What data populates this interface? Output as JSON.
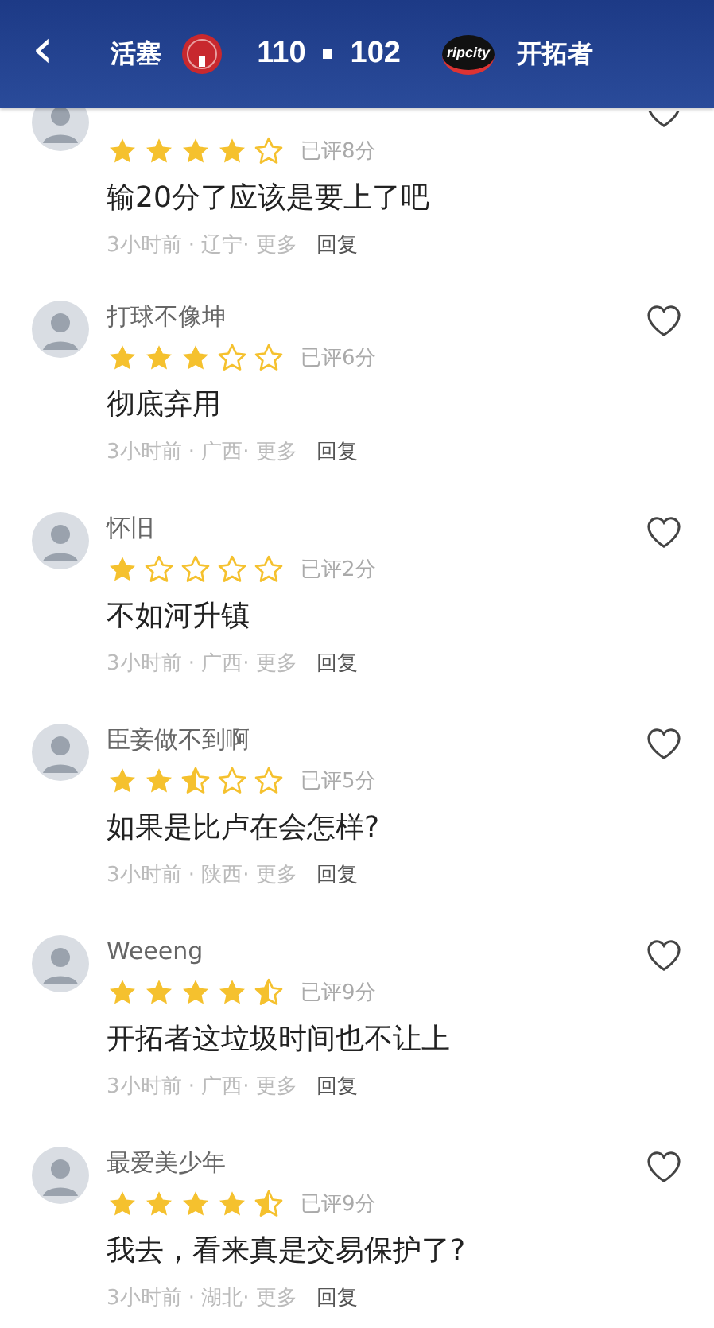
{
  "header": {
    "back": "‹",
    "home_team": "活塞",
    "home_score": "110",
    "away_score": "102",
    "away_logo_text": "ripcity",
    "away_team": "开拓者"
  },
  "comments": [
    {
      "stars": 4,
      "score": "已评8分",
      "text": "输20分了应该是要上了吧",
      "meta": "3小时前 · 辽宁· 更多",
      "reply": "回复",
      "liked": false
    },
    {
      "name": "打球不像坤",
      "stars": 3,
      "score": "已评6分",
      "text": "彻底弃用",
      "meta": "3小时前 · 广西· 更多",
      "reply": "回复",
      "liked": false
    },
    {
      "name": "怀旧",
      "stars": 1,
      "score": "已评2分",
      "text": "不如河升镇",
      "meta": "3小时前 · 广西· 更多",
      "reply": "回复",
      "liked": false
    },
    {
      "name": "臣妾做不到啊",
      "stars": 2.5,
      "score": "已评5分",
      "text": "如果是比卢在会怎样?",
      "meta": "3小时前 · 陕西· 更多",
      "reply": "回复",
      "liked": false
    },
    {
      "name": "Weeeng",
      "stars": 4.5,
      "score": "已评9分",
      "text": "开拓者这垃圾时间也不让上",
      "meta": "3小时前 · 广西· 更多",
      "reply": "回复",
      "liked": false
    },
    {
      "name": "最爱美少年",
      "stars": 4.5,
      "score": "已评9分",
      "text": "我去，看来真是交易保护了?",
      "meta": "3小时前 · 湖北· 更多",
      "reply": "回复",
      "liked": false
    }
  ]
}
